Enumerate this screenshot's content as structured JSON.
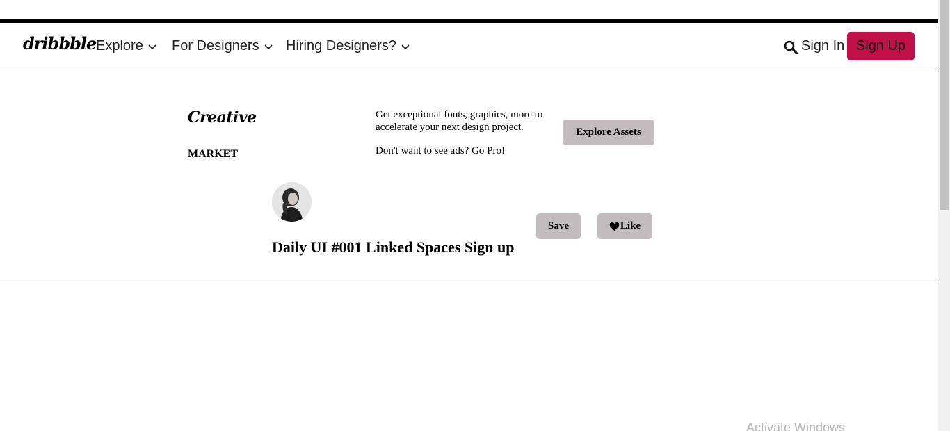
{
  "nav": {
    "logo": "dribbble",
    "items": [
      {
        "label": "Explore",
        "icon": "chevron-down-icon"
      },
      {
        "label": "For Designers",
        "icon": "chevron-down-icon"
      },
      {
        "label": "Hiring Designers?",
        "icon": "chevron-down-icon"
      }
    ],
    "search_icon": "search-icon",
    "sign_in": "Sign In",
    "sign_up": "Sign Up"
  },
  "ad": {
    "logo_line1": "Creative",
    "logo_line2": "MARKET",
    "text": "Get exceptional fonts, graphics, more to accelerate your next design project.",
    "pro_text": "Don't want to see ads? Go Pro!",
    "button": "Explore Assets"
  },
  "shot": {
    "title": "Daily UI #001 Linked Spaces Sign up",
    "save_label": "Save",
    "like_label": "Like",
    "like_icon": "heart-icon"
  },
  "watermark": "Activate Windows",
  "colors": {
    "accent": "#c0114a",
    "button_gray": "#c2bcbe"
  }
}
